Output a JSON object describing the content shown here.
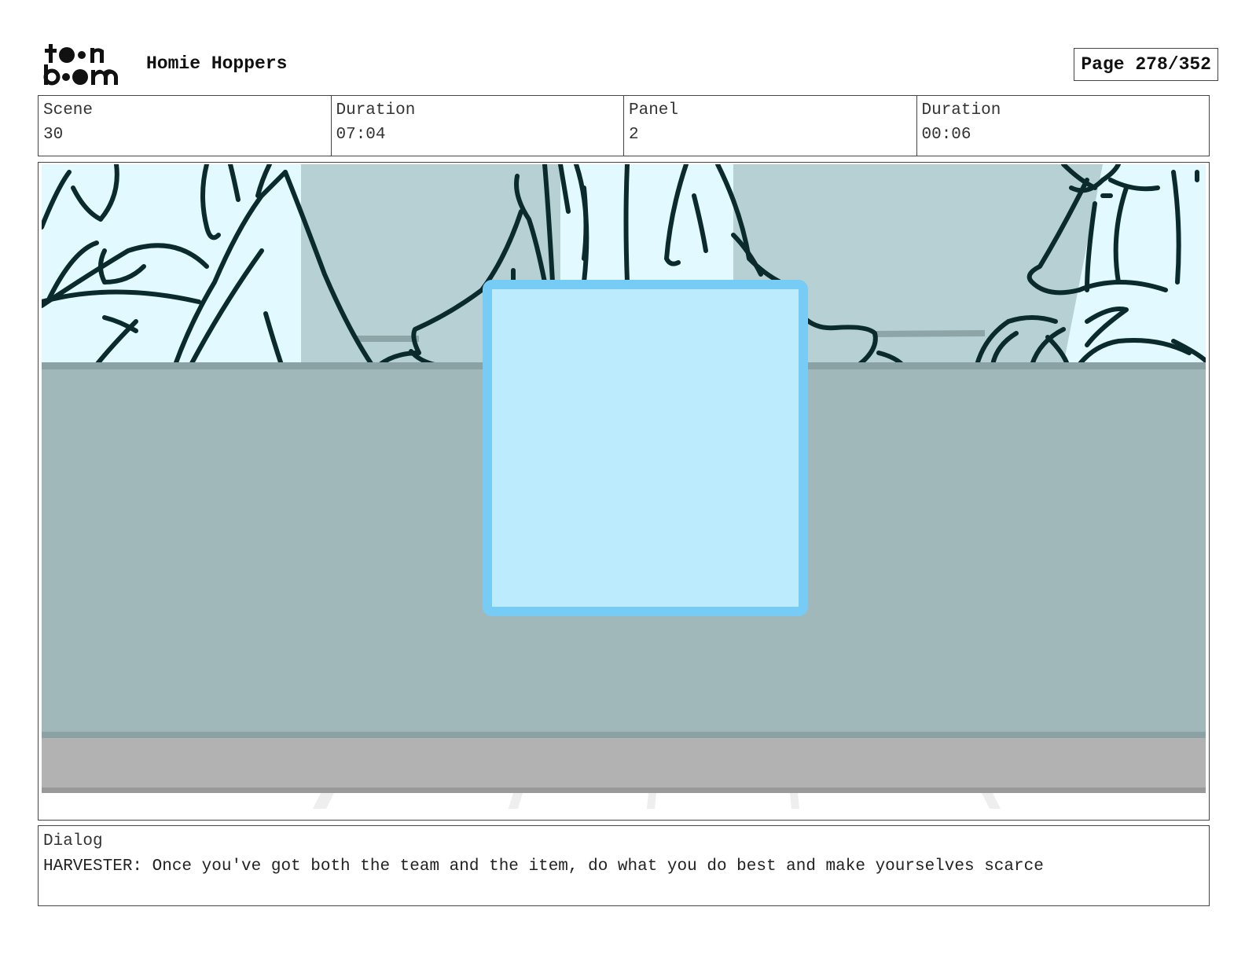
{
  "header": {
    "logo_text": "toon boom",
    "project_title": "Homie Hoppers",
    "page_label": "Page 278/352"
  },
  "info": {
    "scene_label": "Scene",
    "scene_value": "30",
    "scene_duration_label": "Duration",
    "scene_duration_value": "07:04",
    "panel_label": "Panel",
    "panel_value": "2",
    "panel_duration_label": "Duration",
    "panel_duration_value": "00:06"
  },
  "dialog": {
    "label": "Dialog",
    "text": "HARVESTER: Once you've got both the team and the item, do what you do best and make yourselves scarce"
  },
  "colors": {
    "sky": "#e2faff",
    "back_wall": "#b6d0d4",
    "counter": "#a0b8ba",
    "counter_edge": "#8aa2a4",
    "floor_strip": "#b2b2b2",
    "screen_fill": "#bbebfc",
    "screen_border": "#77ccf6",
    "ink": "#0b2a2c"
  }
}
